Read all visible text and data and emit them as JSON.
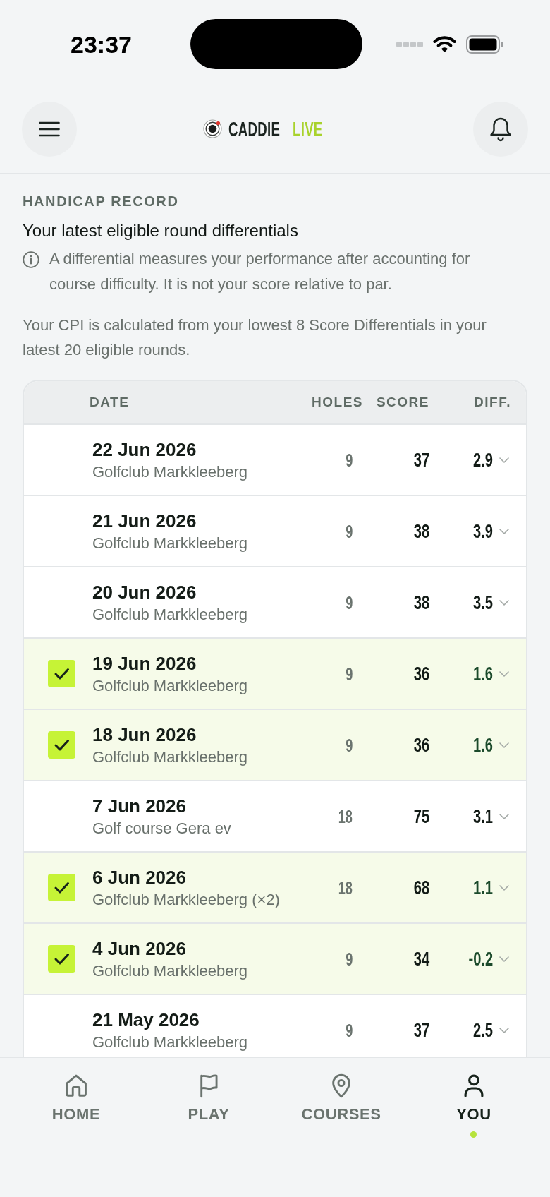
{
  "status_bar": {
    "time": "23:37"
  },
  "header": {
    "logo": {
      "name": "CADDIE",
      "tag": "LIVE"
    }
  },
  "intro": {
    "eyebrow": "HANDICAP RECORD",
    "title": "Your latest eligible round differentials",
    "info": "A differential measures your performance after accounting for course difficulty. It is not your score relative to par.",
    "note": "Your CPI is calculated from your lowest 8 Score Differentials in your latest 20 eligible rounds."
  },
  "table": {
    "columns": [
      "DATE",
      "HOLES",
      "SCORE",
      "DIFF."
    ],
    "rows": [
      {
        "date": "22 Jun 2026",
        "course": "Golfclub Markkleeberg",
        "holes": "9",
        "score": "37",
        "diff": "2.9",
        "checked": false
      },
      {
        "date": "21 Jun 2026",
        "course": "Golfclub Markkleeberg",
        "holes": "9",
        "score": "38",
        "diff": "3.9",
        "checked": false
      },
      {
        "date": "20 Jun 2026",
        "course": "Golfclub Markkleeberg",
        "holes": "9",
        "score": "38",
        "diff": "3.5",
        "checked": false
      },
      {
        "date": "19 Jun 2026",
        "course": "Golfclub Markkleeberg",
        "holes": "9",
        "score": "36",
        "diff": "1.6",
        "checked": true
      },
      {
        "date": "18 Jun 2026",
        "course": "Golfclub Markkleeberg",
        "holes": "9",
        "score": "36",
        "diff": "1.6",
        "checked": true
      },
      {
        "date": "7 Jun 2026",
        "course": "Golf course Gera ev",
        "holes": "18",
        "score": "75",
        "diff": "3.1",
        "checked": false
      },
      {
        "date": "6 Jun 2026",
        "course": "Golfclub Markkleeberg (×2)",
        "holes": "18",
        "score": "68",
        "diff": "1.1",
        "checked": true
      },
      {
        "date": "4 Jun 2026",
        "course": "Golfclub Markkleeberg",
        "holes": "9",
        "score": "34",
        "diff": "-0.2",
        "checked": true
      },
      {
        "date": "21 May 2026",
        "course": "Golfclub Markkleeberg",
        "holes": "9",
        "score": "37",
        "diff": "2.5",
        "checked": false
      }
    ]
  },
  "bottom_nav": {
    "items": [
      {
        "label": "HOME",
        "selected": false
      },
      {
        "label": "PLAY",
        "selected": false
      },
      {
        "label": "COURSES",
        "selected": false
      },
      {
        "label": "YOU",
        "selected": true
      }
    ]
  }
}
